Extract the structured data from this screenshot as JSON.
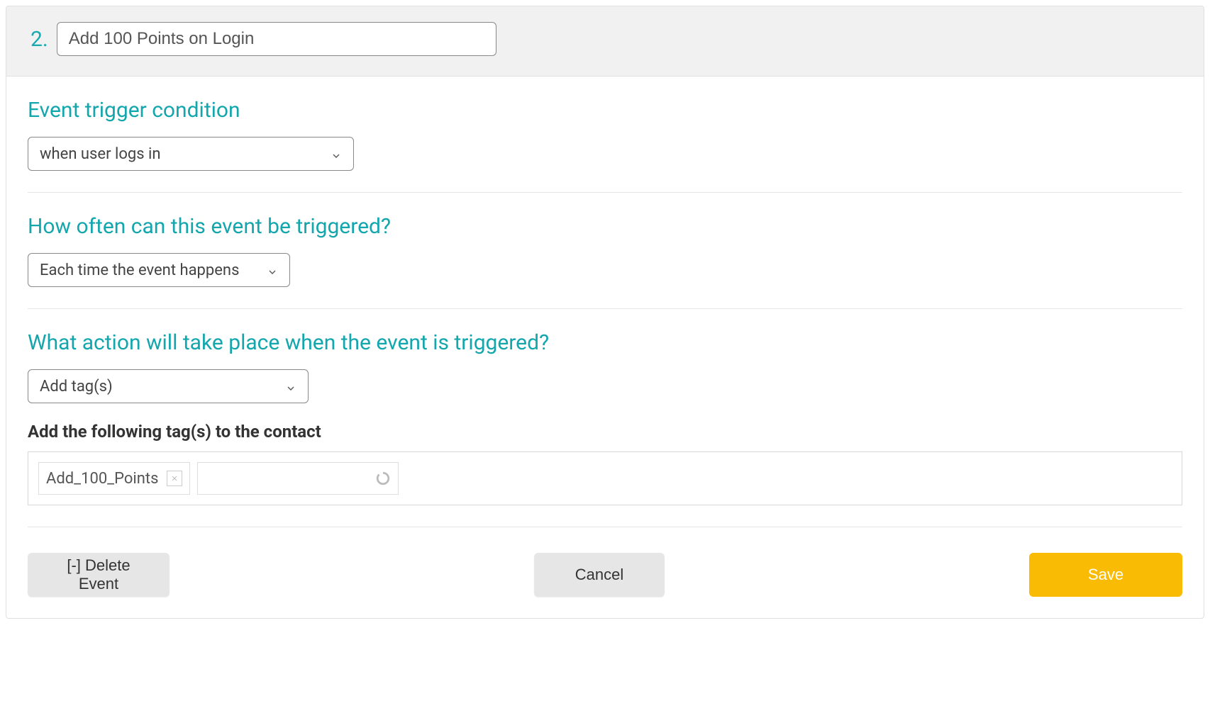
{
  "header": {
    "step_number": "2.",
    "title_value": "Add 100 Points on Login"
  },
  "sections": {
    "trigger": {
      "heading": "Event trigger condition",
      "selected": "when user logs in"
    },
    "frequency": {
      "heading": "How often can this event be triggered?",
      "selected": "Each time the event happens"
    },
    "action": {
      "heading": "What action will take place when the event is triggered?",
      "selected": "Add tag(s)",
      "sub_label": "Add the following tag(s) to the contact",
      "tag_value": "Add_100_Points"
    }
  },
  "footer": {
    "delete_label": "[-] Delete Event",
    "cancel_label": "Cancel",
    "save_label": "Save"
  }
}
